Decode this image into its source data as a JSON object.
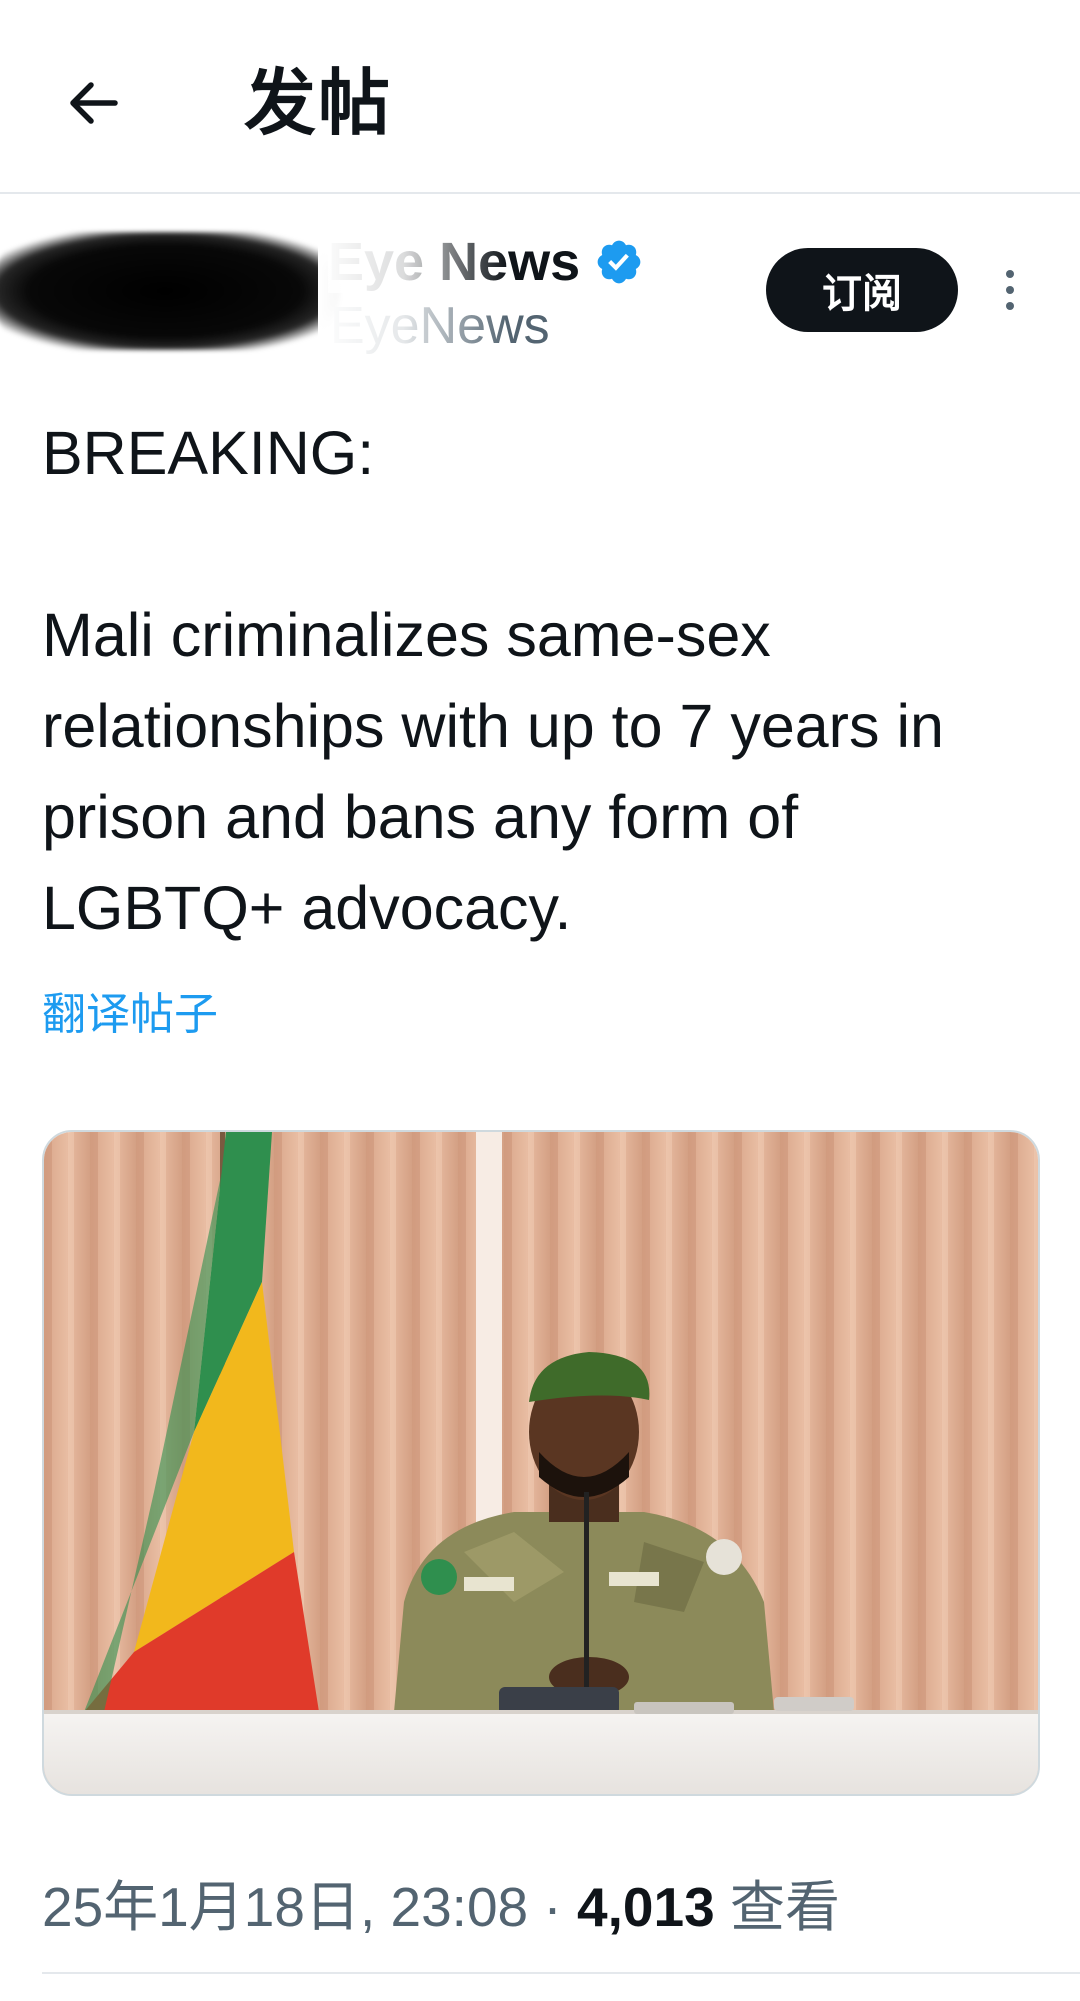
{
  "header": {
    "title": "发帖",
    "back_icon": "arrow-left-icon"
  },
  "author": {
    "display_name": "Eye News",
    "handle": "EyeNews",
    "verified_icon": "verified-badge-icon",
    "verified_color": "#1d9bf0",
    "subscribe_label": "订阅",
    "more_icon": "more-vertical-icon"
  },
  "post": {
    "text": "BREAKING:\n\nMali criminalizes same-sex relationships with up to 7 years in prison and bans any form of LGBTQ+ advocacy.",
    "translate_label": "翻译帖子",
    "media_description_icon": "photo-icon",
    "timestamp": "25年1月18日, 23:08",
    "separator": "·",
    "views_count": "4,013",
    "views_label": "查看"
  },
  "colors": {
    "text_primary": "#0f1419",
    "text_secondary": "#536471",
    "link": "#1d9bf0",
    "divider": "#e4e8ec"
  }
}
